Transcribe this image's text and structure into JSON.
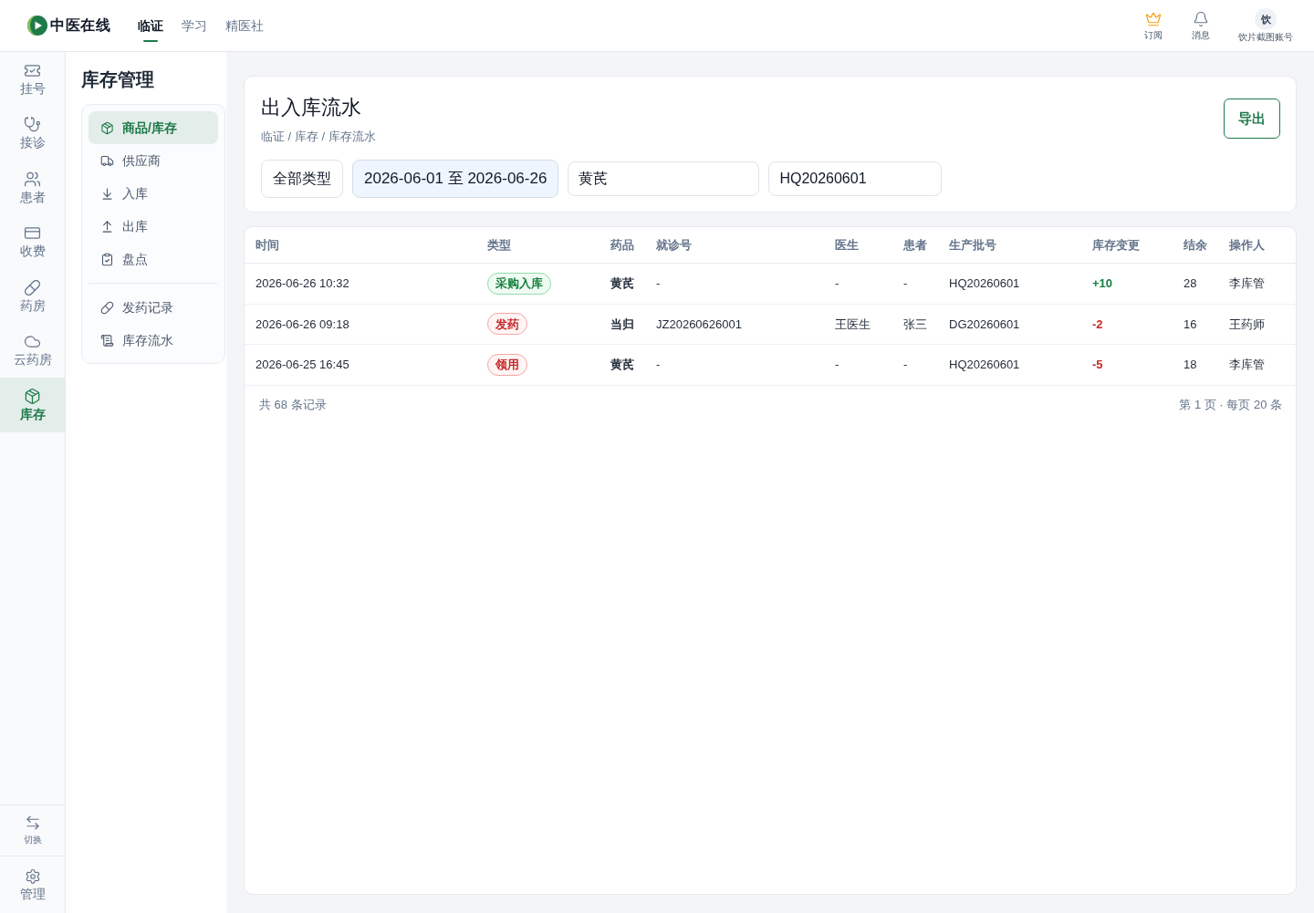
{
  "top_bar": {
    "logo": {
      "text": "中医在线"
    },
    "nav_tabs": [
      {
        "label": "临证",
        "selected": true
      },
      {
        "label": "学习",
        "selected": false
      },
      {
        "label": "精医社",
        "selected": false
      }
    ],
    "actions": [
      {
        "kind": "subscribe",
        "label": "订阅"
      },
      {
        "kind": "messages",
        "label": "消息"
      }
    ],
    "account": {
      "avatar_text": "饮",
      "name": "饮片截图账号"
    }
  },
  "rail": {
    "items": [
      {
        "label": "挂号",
        "selected": false
      },
      {
        "label": "接诊",
        "selected": false
      },
      {
        "label": "患者",
        "selected": false
      },
      {
        "label": "收费",
        "selected": false
      },
      {
        "label": "药房",
        "selected": false
      },
      {
        "label": "云药房",
        "selected": false
      },
      {
        "label": "库存",
        "selected": true
      }
    ],
    "bottom_items": [
      {
        "label": "切换"
      },
      {
        "label": "管理"
      }
    ]
  },
  "sidebar": {
    "title": "库存管理",
    "groups": [
      {
        "items": [
          {
            "label": "商品/库存",
            "selected": true
          },
          {
            "label": "供应商",
            "selected": false
          },
          {
            "label": "入库",
            "selected": false
          },
          {
            "label": "出库",
            "selected": false
          },
          {
            "label": "盘点",
            "selected": false
          }
        ]
      },
      {
        "items": [
          {
            "label": "发药记录",
            "selected": false
          },
          {
            "label": "库存流水",
            "selected": false
          }
        ]
      }
    ]
  },
  "page_header": {
    "title": "出入库流水",
    "breadcrumb": "临证 / 库存 / 库存流水",
    "export_button": "导出",
    "filters": {
      "type_select": "全部类型",
      "date_range": "2026-06-01 至 2026-06-26",
      "drug_field": "黄芪",
      "batch_field": "HQ20260601"
    }
  },
  "table": {
    "columns": [
      "时间",
      "类型",
      "药品",
      "就诊号",
      "医生",
      "患者",
      "生产批号",
      "库存变更",
      "结余",
      "操作人"
    ],
    "rows": [
      {
        "time": "2026-06-26 10:32",
        "type": {
          "label": "采购入库",
          "kind": "inbound"
        },
        "drug": "黄芪",
        "visit_no": "-",
        "doctor": "-",
        "patient": "-",
        "batch": "HQ20260601",
        "change": {
          "text": "+10",
          "kind": "increase"
        },
        "balance": "28",
        "operator": "李库管"
      },
      {
        "time": "2026-06-26 09:18",
        "type": {
          "label": "发药",
          "kind": "outbound"
        },
        "drug": "当归",
        "visit_no": "JZ20260626001",
        "doctor": "王医生",
        "patient": "张三",
        "batch": "DG20260601",
        "change": {
          "text": "-2",
          "kind": "decrease"
        },
        "balance": "16",
        "operator": "王药师"
      },
      {
        "time": "2026-06-25 16:45",
        "type": {
          "label": "领用",
          "kind": "outbound"
        },
        "drug": "黄芪",
        "visit_no": "-",
        "doctor": "-",
        "patient": "-",
        "batch": "HQ20260601",
        "change": {
          "text": "-5",
          "kind": "decrease"
        },
        "balance": "18",
        "operator": "李库管"
      }
    ],
    "footer": {
      "total": "共 68 条记录",
      "pagination": "第 1 页 · 每页 20 条"
    }
  }
}
